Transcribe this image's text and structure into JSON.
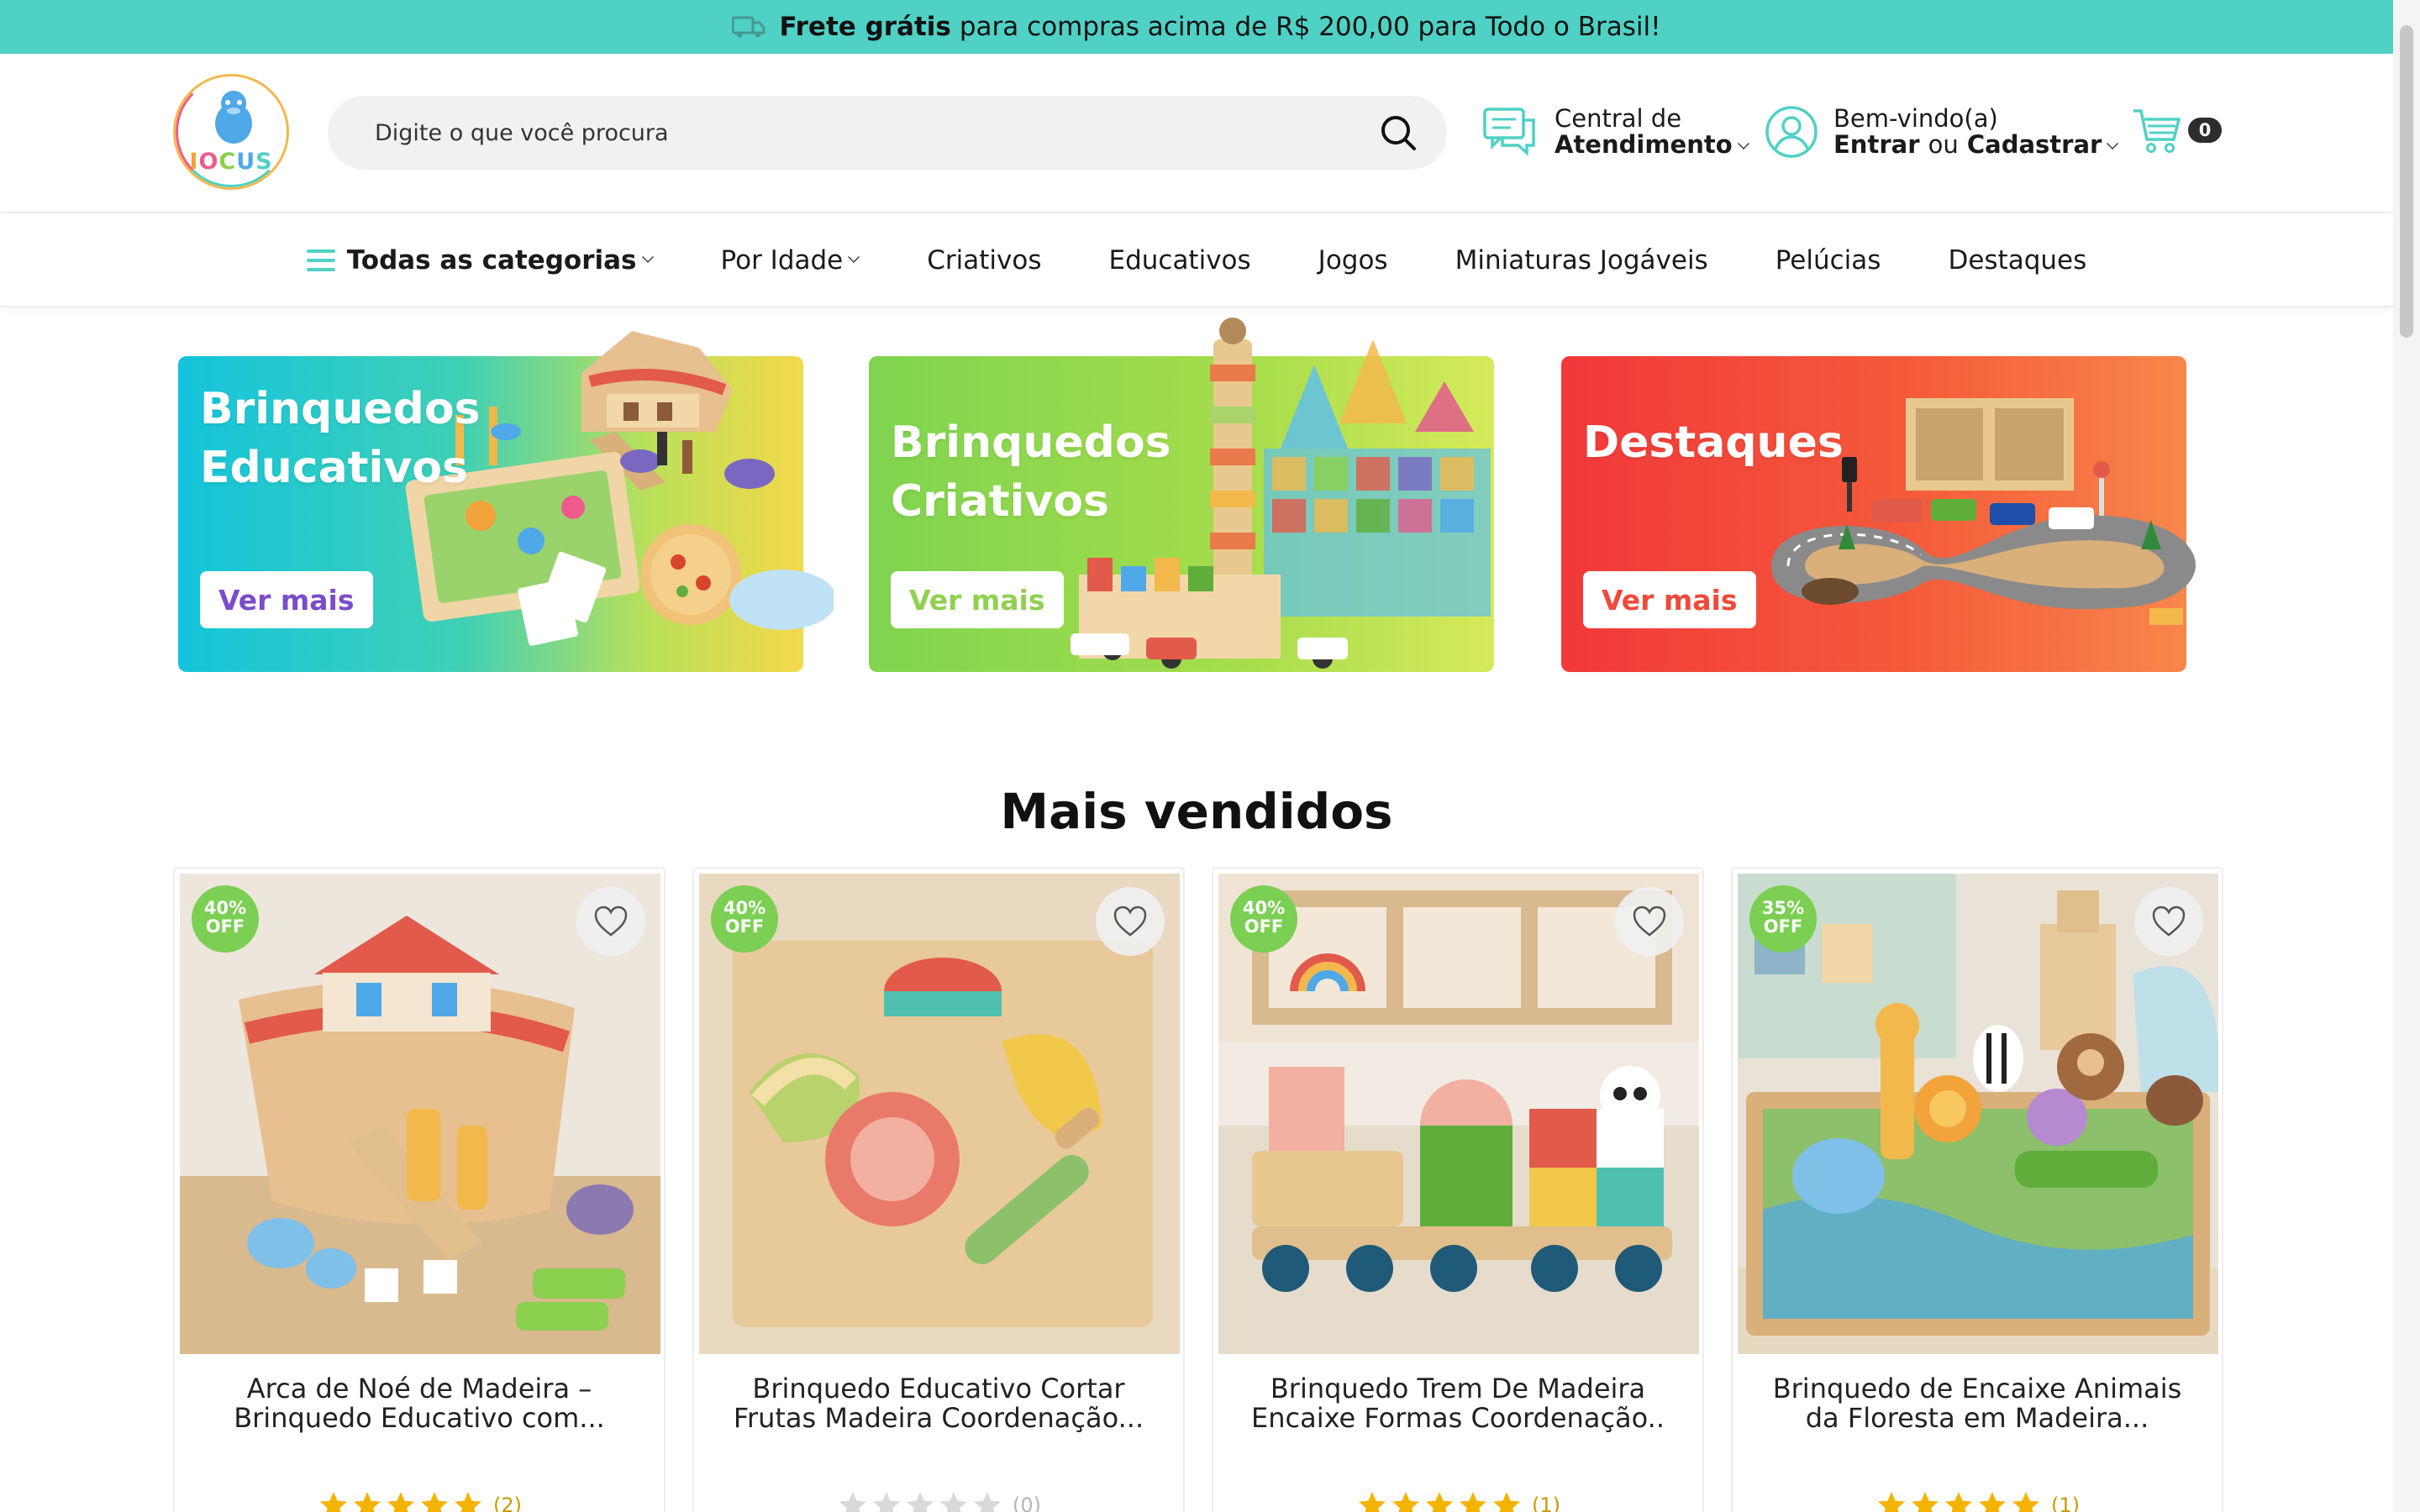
{
  "promo": {
    "bold": "Frete grátis",
    "text": "para compras acima de R$ 200,00 para Todo o Brasil!"
  },
  "brand": {
    "logo_text": "IOCUS"
  },
  "search": {
    "placeholder": "Digite o que você procura"
  },
  "support": {
    "line1": "Central de",
    "line2": "Atendimento"
  },
  "account": {
    "line1": "Bem-vindo(a)",
    "login": "Entrar",
    "or": "ou",
    "register": "Cadastrar"
  },
  "cart": {
    "count": "0"
  },
  "nav": {
    "all_categories": "Todas as categorias",
    "by_age": "Por Idade",
    "items": [
      "Criativos",
      "Educativos",
      "Jogos",
      "Miniaturas Jogáveis",
      "Pelúcias",
      "Destaques"
    ]
  },
  "banners": [
    {
      "line1": "Brinquedos",
      "line2": "Educativos",
      "button": "Ver mais",
      "button_color": "#7b4cc9"
    },
    {
      "line1": "Brinquedos",
      "line2": "Criativos",
      "button": "Ver mais",
      "button_color": "#8fd14f"
    },
    {
      "line1": "Destaques",
      "line2": "",
      "button": "Ver mais",
      "button_color": "#f04a3a"
    }
  ],
  "section": {
    "title": "Mais vendidos"
  },
  "products": [
    {
      "discount_pct": "40%",
      "discount_label": "OFF",
      "name_line1": "Arca de Noé de Madeira –",
      "name_line2": "Brinquedo Educativo com...",
      "rating": 5,
      "reviews": "(2)"
    },
    {
      "discount_pct": "40%",
      "discount_label": "OFF",
      "name_line1": "Brinquedo Educativo Cortar",
      "name_line2": "Frutas Madeira Coordenação...",
      "rating": 0,
      "reviews": "(0)"
    },
    {
      "discount_pct": "40%",
      "discount_label": "OFF",
      "name_line1": "Brinquedo Trem De Madeira",
      "name_line2": "Encaixe Formas Coordenação..",
      "rating": 5,
      "reviews": "(1)"
    },
    {
      "discount_pct": "35%",
      "discount_label": "OFF",
      "name_line1": "Brinquedo de Encaixe Animais",
      "name_line2": "da Floresta em Madeira...",
      "rating": 5,
      "reviews": "(1)"
    }
  ],
  "colors": {
    "accent": "#4fd1c5",
    "discount": "#7bcf52",
    "star": "#f5b301",
    "star_empty": "#d9d9d9"
  }
}
